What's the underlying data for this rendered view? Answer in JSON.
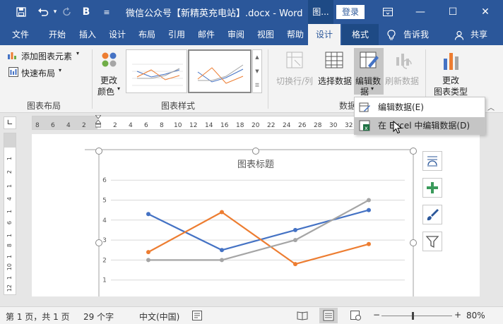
{
  "app": {
    "doc_title": "微信公众号【新精英充电站】.docx - Word",
    "context_title": "图...",
    "login_label": "登录"
  },
  "quick_access": {
    "save_icon": "save-icon",
    "undo_icon": "undo-icon",
    "redo_icon": "redo-icon",
    "bold_label": "B",
    "more_icon": "customize-icon"
  },
  "tabs": [
    {
      "label": "文件"
    },
    {
      "label": "开始"
    },
    {
      "label": "插入"
    },
    {
      "label": "设计"
    },
    {
      "label": "布局"
    },
    {
      "label": "引用"
    },
    {
      "label": "邮件"
    },
    {
      "label": "审阅"
    },
    {
      "label": "视图"
    },
    {
      "label": "帮助"
    },
    {
      "label": "设计"
    },
    {
      "label": "格式"
    },
    {
      "label": "告诉我"
    },
    {
      "label": "共享"
    }
  ],
  "ribbon": {
    "add_element": "添加图表元素",
    "quick_layout": "快速布局",
    "change_color_1": "更改",
    "change_color_2": "颜色",
    "group_layout": "图表布局",
    "group_styles": "图表样式",
    "switch_row_col": "切换行/列",
    "select_data": "选择数据",
    "edit_data_1": "编辑数",
    "edit_data_2": "据",
    "refresh_data": "刷新数据",
    "group_data": "数据",
    "change_type_1": "更改",
    "change_type_2": "图表类型"
  },
  "dropdown": {
    "item1": "编辑数据(E)",
    "item2": "在 Excel 中编辑数据(D)"
  },
  "ruler": {
    "numbers": [
      "8",
      "6",
      "4",
      "2",
      "",
      "2",
      "4",
      "6",
      "8",
      "10",
      "12",
      "14",
      "16",
      "18",
      "20",
      "22",
      "24",
      "26",
      "28",
      "30",
      "32",
      "34"
    ]
  },
  "vruler": {
    "numbers": [
      "1",
      "2",
      "1",
      "4",
      "1",
      "6",
      "1",
      "8",
      "1",
      "10",
      "1",
      "12"
    ]
  },
  "status": {
    "page": "第 1 页，共 1 页",
    "words": "29 个字",
    "lang": "中文(中国)",
    "zoom": "80%"
  },
  "colors": {
    "accent": "#2b579a",
    "series1": "#4472c4",
    "series2": "#ed7d31",
    "series3": "#a5a5a5"
  },
  "chart_data": {
    "type": "line",
    "title": "图表标题",
    "categories": [
      "",
      "",
      "",
      ""
    ],
    "series": [
      {
        "values": [
          4.3,
          2.5,
          3.5,
          4.5
        ]
      },
      {
        "values": [
          2.4,
          4.4,
          1.8,
          2.8
        ]
      },
      {
        "values": [
          2.0,
          2.0,
          3.0,
          5.0
        ]
      }
    ],
    "yticks": [
      "1",
      "2",
      "3",
      "4",
      "5",
      "6"
    ],
    "ylim": [
      0,
      6
    ],
    "grid": true
  }
}
